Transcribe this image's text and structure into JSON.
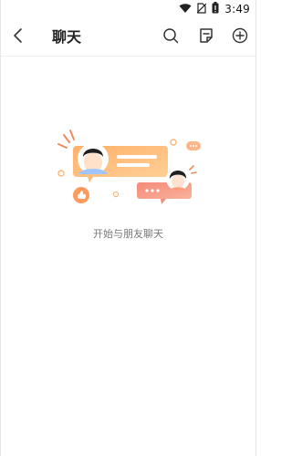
{
  "status_bar": {
    "time": "3:49",
    "icons": [
      "wifi-icon",
      "no-sim-icon",
      "battery-icon"
    ]
  },
  "header": {
    "title": "聊天",
    "icons": {
      "back": "chevron-left-icon",
      "search": "search-icon",
      "note": "note-icon",
      "add": "plus-circle-icon"
    }
  },
  "empty_state": {
    "message": "开始与朋友聊天"
  },
  "colors": {
    "accent_orange": "#f8a15a",
    "accent_pink": "#f46b6b",
    "text_primary": "#222222",
    "text_secondary": "#777777"
  }
}
